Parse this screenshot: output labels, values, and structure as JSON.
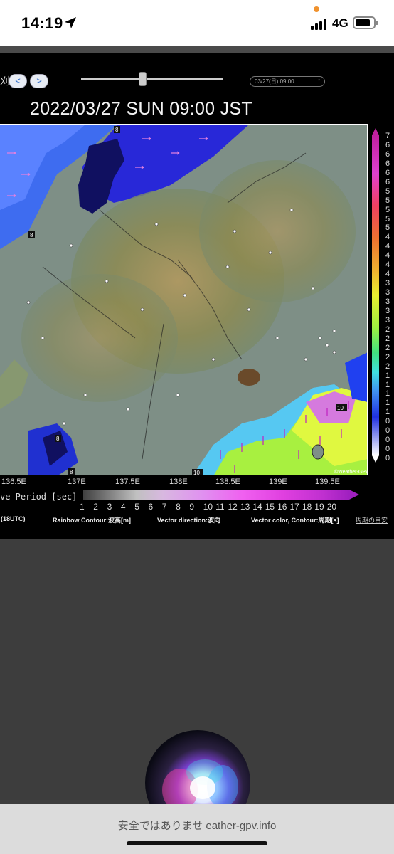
{
  "status_bar": {
    "time": "14:19",
    "network": "4G",
    "icons": [
      "location-arrow-icon",
      "signal-bars-icon",
      "battery-icon"
    ],
    "recording_dot_color": "#f0922e"
  },
  "toolbar": {
    "nav_label": "刈",
    "prev_glyph": "<",
    "next_glyph": ">",
    "date_select_value": "03/27(日) 09:00",
    "slider_level": 0.43
  },
  "headline": "2022/03/27 SUN 09:00 JST",
  "map": {
    "longitudes": [
      "136.5E",
      "137E",
      "137.5E",
      "138E",
      "138.5E",
      "139E",
      "139.5E"
    ],
    "watermark": "©Weather-GPV",
    "station_labels": [
      "8",
      "10",
      "8",
      "8",
      "8",
      "10",
      "10"
    ]
  },
  "height_scale": {
    "labels": [
      "7",
      "6",
      "6",
      "6",
      "6",
      "6",
      "5",
      "5",
      "5",
      "5",
      "5",
      "4",
      "4",
      "4",
      "4",
      "4",
      "3",
      "3",
      "3",
      "3",
      "3",
      "2",
      "2",
      "2",
      "2",
      "2",
      "1",
      "1",
      "1",
      "1",
      "1",
      "0",
      "0",
      "0",
      "0",
      "0"
    ]
  },
  "period_legend": {
    "label": "ve Period [sec]",
    "numbers": [
      "1",
      "2",
      "3",
      "4",
      "5",
      "6",
      "7",
      "8",
      "9",
      "10",
      "11",
      "12",
      "13",
      "14",
      "15",
      "16",
      "17",
      "18",
      "19",
      "20"
    ]
  },
  "legend_row": {
    "init": "(18UTC)",
    "rainbow": "Rainbow Contour:波高[m]",
    "vector_dir": "Vector direction:波向",
    "vector_color": "Vector color, Contour:周期[s]",
    "period_link": "周期の目安"
  },
  "safari": {
    "url_text": "安全ではありませ                 eather-gpv.info"
  }
}
